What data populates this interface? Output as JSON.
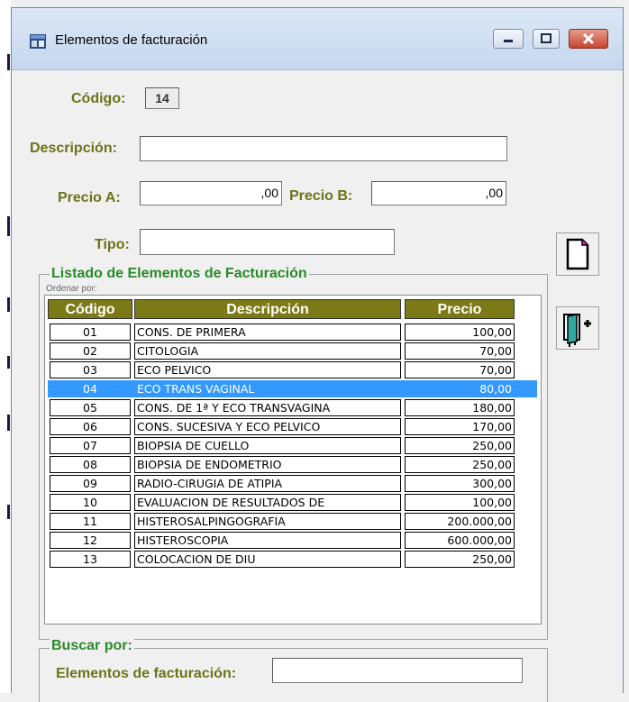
{
  "window": {
    "title": "Elementos de facturación"
  },
  "form": {
    "codigo_label": "Código:",
    "codigo_value": "14",
    "descripcion_label": "Descripción:",
    "descripcion_value": "",
    "precio_a_label": "Precio A:",
    "precio_a_value": ",00",
    "precio_b_label": "Precio B:",
    "precio_b_value": ",00",
    "tipo_label": "Tipo:",
    "tipo_value": ""
  },
  "listado": {
    "title": "Listado de Elementos de Facturación",
    "order_label": "Ordenar por:",
    "columns": [
      "Código",
      "Descripción",
      "Precio"
    ],
    "selected_index": 3,
    "rows": [
      {
        "code": "01",
        "desc": "CONS. DE PRIMERA",
        "price": "100,00"
      },
      {
        "code": "02",
        "desc": "CITOLOGIA",
        "price": "70,00"
      },
      {
        "code": "03",
        "desc": "ECO PELVICO",
        "price": "70,00"
      },
      {
        "code": "04",
        "desc": "ECO TRANS VAGINAL",
        "price": "80,00"
      },
      {
        "code": "05",
        "desc": "CONS. DE 1ª Y ECO TRANSVAGINA",
        "price": "180,00"
      },
      {
        "code": "06",
        "desc": "CONS. SUCESIVA Y ECO PELVICO",
        "price": "170,00"
      },
      {
        "code": "07",
        "desc": "BIOPSIA DE CUELLO",
        "price": "250,00"
      },
      {
        "code": "08",
        "desc": "BIOPSIA DE ENDOMETRIO",
        "price": "250,00"
      },
      {
        "code": "09",
        "desc": "RADIO-CIRUGIA DE ATIPIA",
        "price": "300,00"
      },
      {
        "code": "10",
        "desc": "EVALUACION DE RESULTADOS DE",
        "price": "100,00"
      },
      {
        "code": "11",
        "desc": "HISTEROSALPINGOGRAFIA",
        "price": "200.000,00"
      },
      {
        "code": "12",
        "desc": "HISTEROSCOPIA",
        "price": "600.000,00"
      },
      {
        "code": "13",
        "desc": "COLOCACION DE DIU",
        "price": "250,00"
      }
    ]
  },
  "buscar": {
    "title": "Buscar por:",
    "label": "Elementos de facturación:",
    "value": ""
  },
  "icons": {
    "new": "new-document-icon",
    "exit": "exit-door-icon"
  },
  "colors": {
    "label": "#6b7418",
    "header_bg": "#7c7a16",
    "group_title": "#2a8a2a",
    "selection": "#3399ff"
  }
}
